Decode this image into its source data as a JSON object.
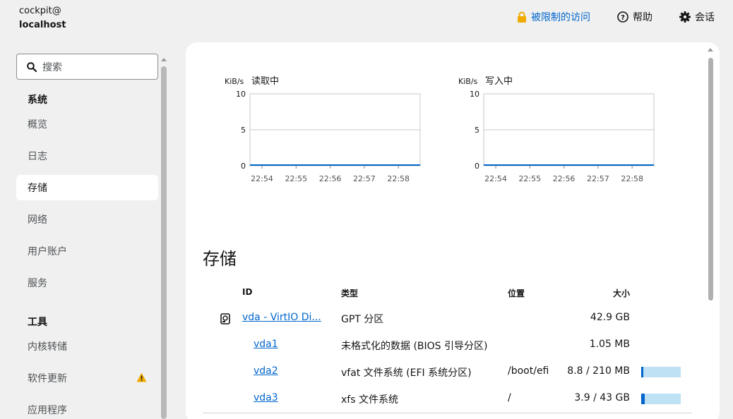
{
  "host": {
    "user": "cockpit@",
    "name": "localhost"
  },
  "topnav": {
    "access_label": "被限制的访问",
    "help_label": "帮助",
    "session_label": "会话"
  },
  "sidebar": {
    "search_placeholder": "搜索",
    "system_heading": "系统",
    "items": [
      {
        "label": "概览"
      },
      {
        "label": "日志"
      },
      {
        "label": "存储"
      },
      {
        "label": "网络"
      },
      {
        "label": "用户账户"
      },
      {
        "label": "服务"
      }
    ],
    "tools_heading": "工具",
    "tools": [
      {
        "label": "内核转储"
      },
      {
        "label": "软件更新"
      },
      {
        "label": "应用程序"
      }
    ]
  },
  "colors": {
    "accent": "#0066cc",
    "warning": "#f0ab00",
    "bar_bg": "#bee1f4"
  },
  "charts": [
    {
      "unit": "KiB/s",
      "title": "读取中",
      "yticks": [
        "10",
        "5",
        "0"
      ],
      "xticks": [
        "22:54",
        "22:55",
        "22:56",
        "22:57",
        "22:58"
      ]
    },
    {
      "unit": "KiB/s",
      "title": "写入中",
      "yticks": [
        "10",
        "5",
        "0"
      ],
      "xticks": [
        "22:54",
        "22:55",
        "22:56",
        "22:57",
        "22:58"
      ]
    }
  ],
  "chart_data": [
    {
      "type": "line",
      "title": "读取中",
      "ylabel": "KiB/s",
      "x": [
        "22:54",
        "22:55",
        "22:56",
        "22:57",
        "22:58"
      ],
      "series": [
        {
          "values": [
            0,
            0,
            0,
            0,
            0
          ]
        }
      ],
      "ylim": [
        0,
        10
      ],
      "grid": true
    },
    {
      "type": "line",
      "title": "写入中",
      "ylabel": "KiB/s",
      "x": [
        "22:54",
        "22:55",
        "22:56",
        "22:57",
        "22:58"
      ],
      "series": [
        {
          "values": [
            0,
            0,
            0,
            0,
            0
          ]
        }
      ],
      "ylim": [
        0,
        10
      ],
      "grid": true
    }
  ],
  "storage": {
    "title": "存储",
    "headers": {
      "id": "ID",
      "type": "类型",
      "location": "位置",
      "size": "大小"
    },
    "rows": [
      {
        "id": "vda - VirtIO Di...",
        "type": "GPT 分区",
        "location": "",
        "size": "42.9 GB"
      },
      {
        "id": "vda1",
        "type": "未格式化的数据 (BIOS 引导分区)",
        "location": "",
        "size": "1.05 MB"
      },
      {
        "id": "vda2",
        "type": "vfat 文件系统 (EFI 系统分区)",
        "location": "/boot/efi",
        "size": "8.8 / 210 MB",
        "usage": 0.042
      },
      {
        "id": "vda3",
        "type": "xfs 文件系统",
        "location": "/",
        "size": "3.9 / 43 GB",
        "usage": 0.091
      }
    ]
  }
}
